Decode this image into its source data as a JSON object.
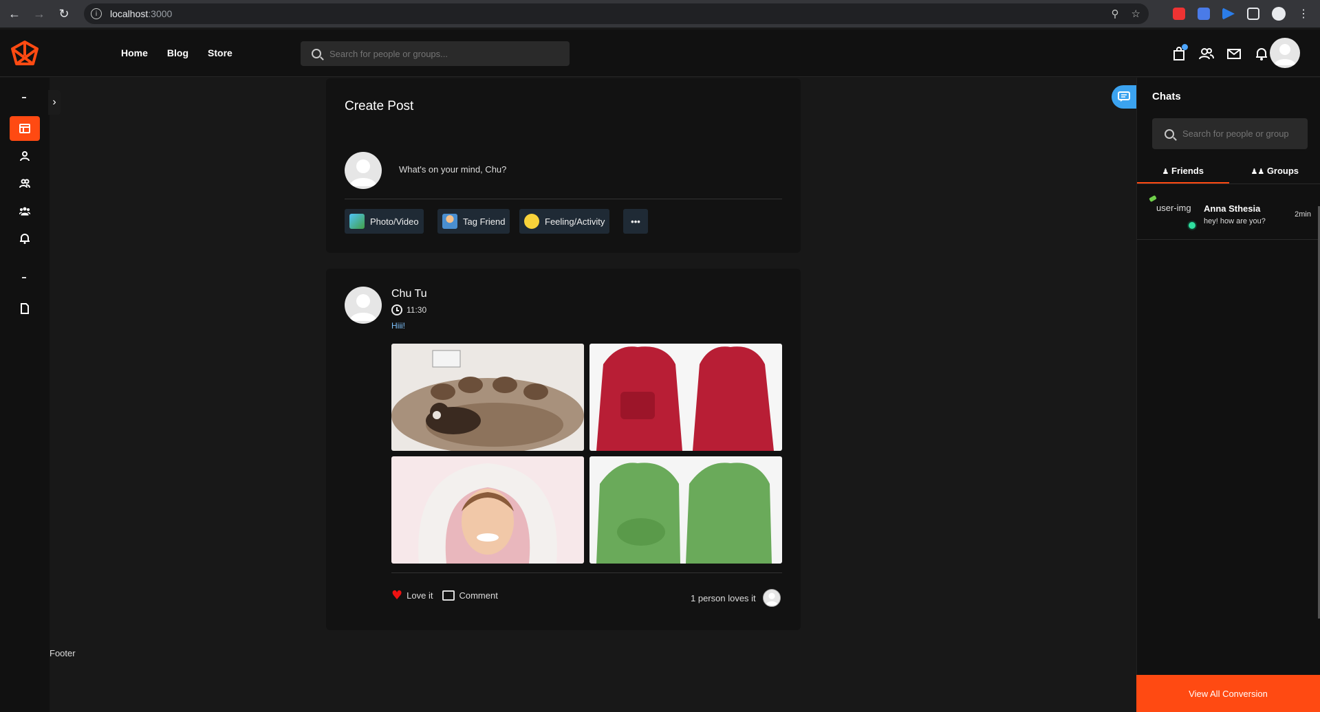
{
  "browser": {
    "host": "localhost",
    "port": ":3000"
  },
  "header": {
    "nav": [
      "Home",
      "Blog",
      "Store"
    ],
    "search_placeholder": "Search for people or groups..."
  },
  "sidebar": {
    "dash_top": "-",
    "dash_mid": "-"
  },
  "create_post": {
    "title": "Create Post",
    "prompt": "What's on your mind, Chu?",
    "actions": [
      "Photo/Video",
      "Tag Friend",
      "Feeling/Activity"
    ],
    "more": "•••"
  },
  "post": {
    "author": "Chu Tu",
    "time": "11:30",
    "text": "Hiii!",
    "love_label": "Love it",
    "comment_label": "Comment",
    "loves_count_text": "1 person loves it"
  },
  "footer": {
    "text": "Footer"
  },
  "chats": {
    "title": "Chats",
    "search_placeholder": "Search for people or group",
    "tabs": [
      "Friends",
      "Groups"
    ],
    "items": [
      {
        "img_alt": "user-img",
        "name": "Anna Sthesia",
        "message": "hey! how are you?",
        "time": "2min"
      }
    ],
    "view_all": "View All Conversion"
  },
  "colors": {
    "accent": "#ff4a12",
    "chat_float": "#3ba3f0",
    "online": "#2fe0a0"
  }
}
